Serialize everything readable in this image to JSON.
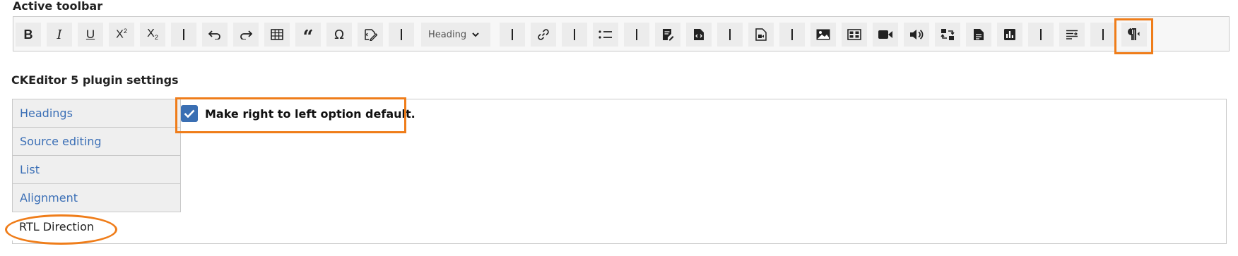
{
  "toolbar_section": {
    "title": "Active toolbar",
    "heading_dropdown": {
      "label": "Heading"
    }
  },
  "plugin_section": {
    "title": "CKEditor 5 plugin settings",
    "tabs": [
      {
        "label": "Headings"
      },
      {
        "label": "Source editing"
      },
      {
        "label": "List"
      },
      {
        "label": "Alignment"
      },
      {
        "label": "RTL Direction"
      }
    ],
    "rtl_checkbox": {
      "label": "Make right to left option default.",
      "checked": true
    }
  },
  "colors": {
    "highlight": "#ef7d1a",
    "link": "#3b6fb6",
    "checkbox": "#3a6fb3"
  }
}
